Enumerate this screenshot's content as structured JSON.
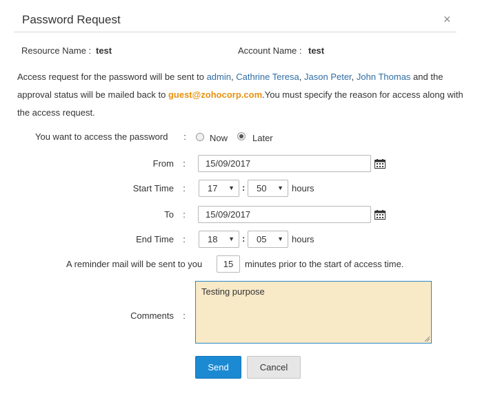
{
  "dialog": {
    "title": "Password Request",
    "close": "×"
  },
  "resource": {
    "label": "Resource Name :",
    "value": "test"
  },
  "account": {
    "label": "Account Name :",
    "value": "test"
  },
  "message": {
    "prefix": "Access request for the password will be sent to ",
    "approvers": [
      "admin",
      "Cathrine Teresa",
      "Jason Peter",
      "John Thomas"
    ],
    "middle": " and the approval status will be mailed back to ",
    "email": "guest@zohocorp.com",
    "suffix": ".You must specify the reason for access along with the access request."
  },
  "access": {
    "label": "You want to access the password",
    "options": [
      "Now",
      "Later"
    ],
    "selected": "Later"
  },
  "from": {
    "label": "From",
    "value": "15/09/2017"
  },
  "start_time": {
    "label": "Start Time",
    "hour": "17",
    "minute": "50",
    "unit": "hours"
  },
  "to": {
    "label": "To",
    "value": "15/09/2017"
  },
  "end_time": {
    "label": "End Time",
    "hour": "18",
    "minute": "05",
    "unit": "hours"
  },
  "reminder": {
    "prefix": "A reminder mail will be sent to you",
    "value": "15",
    "suffix": "minutes prior to the start of access time."
  },
  "comments": {
    "label": "Comments",
    "value": "Testing purpose"
  },
  "buttons": {
    "send": "Send",
    "cancel": "Cancel"
  },
  "colors": {
    "accent": "#1b8ad3",
    "email": "#e8910e",
    "link": "#2e6da4",
    "comment_bg": "#f8e9c7"
  }
}
